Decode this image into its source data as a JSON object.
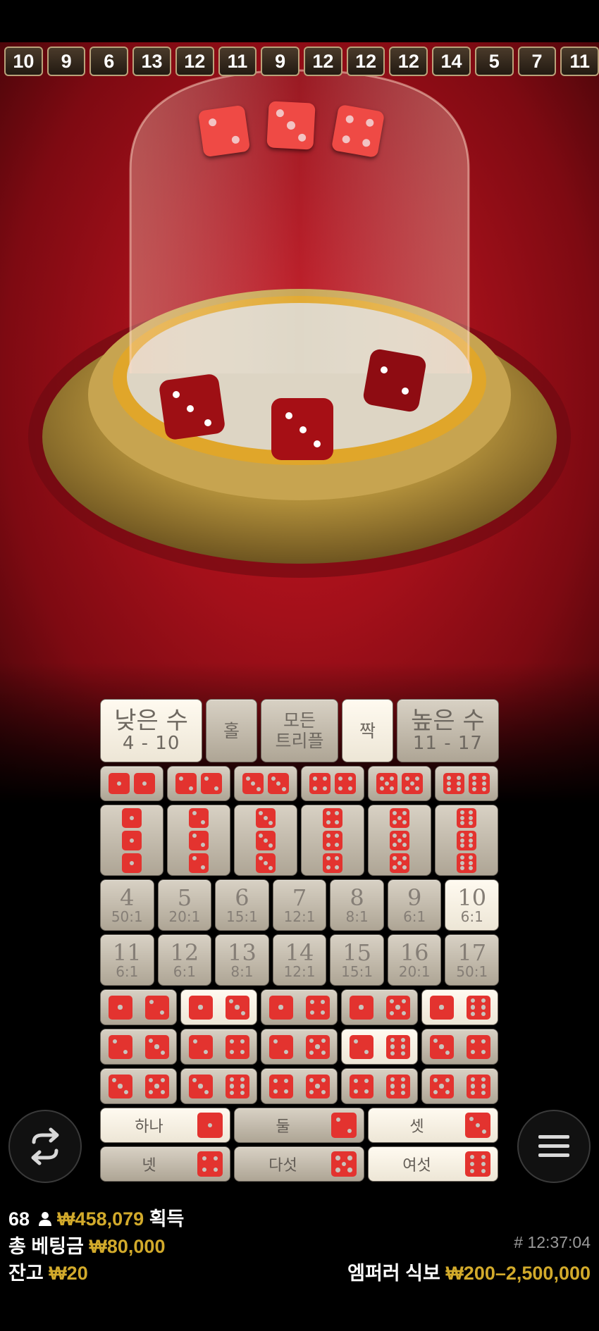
{
  "history": [
    "10",
    "9",
    "6",
    "13",
    "12",
    "11",
    "9",
    "12",
    "12",
    "12",
    "14",
    "5",
    "7",
    "11"
  ],
  "result_dice": [
    2,
    3,
    4
  ],
  "board": {
    "small": {
      "label": "낮은 수",
      "range": "4 - 10"
    },
    "odd": {
      "label": "홀"
    },
    "any_triple": {
      "line1": "모든",
      "line2": "트리플"
    },
    "even": {
      "label": "짝"
    },
    "big": {
      "label": "높은 수",
      "range": "11 - 17"
    },
    "totals_row1": [
      {
        "num": "4",
        "odds": "50:1"
      },
      {
        "num": "5",
        "odds": "20:1"
      },
      {
        "num": "6",
        "odds": "15:1"
      },
      {
        "num": "7",
        "odds": "12:1"
      },
      {
        "num": "8",
        "odds": "8:1"
      },
      {
        "num": "9",
        "odds": "6:1"
      },
      {
        "num": "10",
        "odds": "6:1"
      }
    ],
    "totals_row2": [
      {
        "num": "11",
        "odds": "6:1"
      },
      {
        "num": "12",
        "odds": "6:1"
      },
      {
        "num": "13",
        "odds": "8:1"
      },
      {
        "num": "14",
        "odds": "12:1"
      },
      {
        "num": "15",
        "odds": "15:1"
      },
      {
        "num": "16",
        "odds": "20:1"
      },
      {
        "num": "17",
        "odds": "50:1"
      }
    ],
    "singles": [
      {
        "label": "하나",
        "face": 1
      },
      {
        "label": "둘",
        "face": 2
      },
      {
        "label": "셋",
        "face": 3
      },
      {
        "label": "넷",
        "face": 4
      },
      {
        "label": "다섯",
        "face": 5
      },
      {
        "label": "여섯",
        "face": 6
      }
    ]
  },
  "stats": {
    "winners_count": "68",
    "winnings": "₩458,079",
    "winnings_label": "획득",
    "total_bet_label": "총 베팅금",
    "total_bet": "₩80,000",
    "balance_label": "잔고",
    "balance": "₩20",
    "round_id": "# 12:37:04",
    "table_name": "엠퍼러 식보",
    "limits": "₩200–2,500,000"
  },
  "colors": {
    "accent_gold": "#d2aa2b",
    "die_red": "#e3332f",
    "felt_red": "#b5121b"
  }
}
